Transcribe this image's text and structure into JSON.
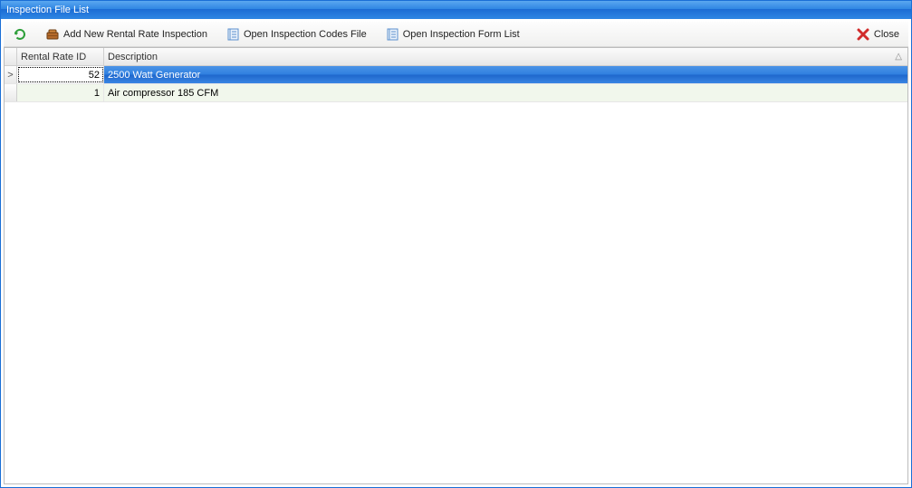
{
  "title": "Inspection File List",
  "toolbar": {
    "refresh_label": "",
    "add_label": "Add New Rental Rate Inspection",
    "open_codes_label": "Open Inspection Codes File",
    "open_forms_label": "Open Inspection Form List",
    "close_label": "Close"
  },
  "grid": {
    "columns": {
      "rental_rate_id": "Rental Rate ID",
      "description": "Description"
    },
    "sort_glyph": "△",
    "rows": [
      {
        "indicator": ">",
        "id": "52",
        "description": "2500 Watt Generator",
        "selected": true
      },
      {
        "indicator": "",
        "id": "1",
        "description": "Air compressor 185 CFM",
        "selected": false
      }
    ]
  }
}
